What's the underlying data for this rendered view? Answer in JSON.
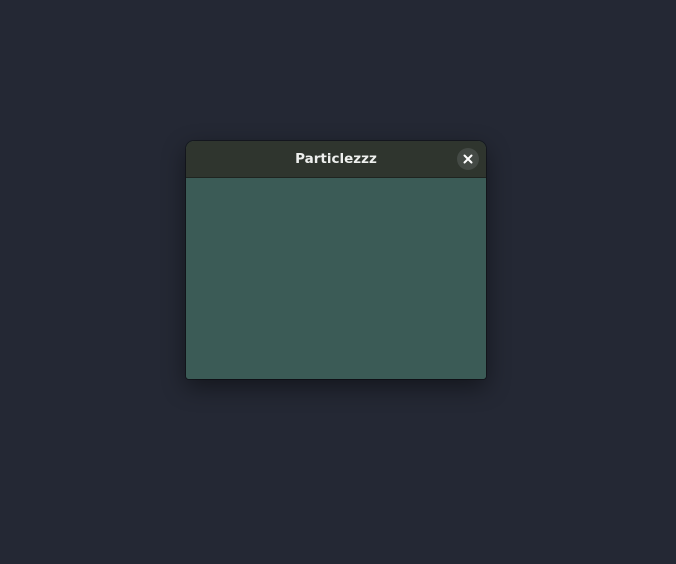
{
  "window": {
    "title": "Particlezzz",
    "close_icon": "close-icon"
  },
  "colors": {
    "desktop_background": "#242834",
    "titlebar_background": "#2f352e",
    "content_background": "#3b5b56",
    "title_text": "#eef0ee",
    "close_button_background": "#444a45"
  }
}
